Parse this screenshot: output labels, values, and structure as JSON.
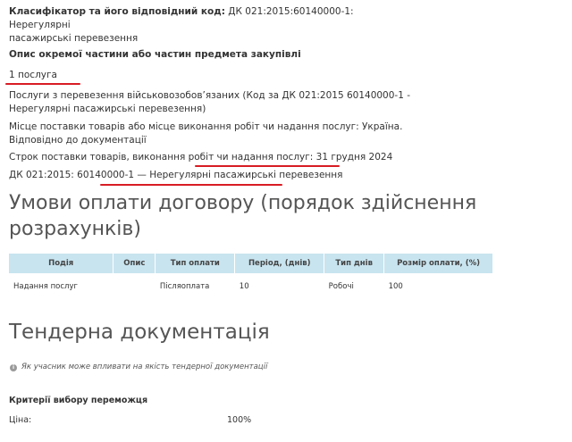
{
  "classifier": {
    "label": "Класифікатор та його відповідний код:",
    "value_line1": "ДК 021:2015:60140000-1: Нерегулярні",
    "value_line2": "пасажирські перевезення"
  },
  "lot_description": {
    "heading": "Опис окремої частини або частин предмета закупівлі",
    "quantity": "1 послуга",
    "service_line1": "Послуги з перевезення військовозобов’язаних (Код за ДК 021:2015 60140000-1 -",
    "service_line2": "Нерегулярні пасажирські перевезення)",
    "place_line1": "Місце поставки товарів або місце виконання робіт чи надання послуг: Україна.",
    "place_line2": "Відповідно до документації",
    "term": "Строк поставки товарів, виконання робіт чи надання послуг: 31 грудня 2024",
    "classifier_code": "ДК 021:2015: 60140000-1 — Нерегулярні пасажирські перевезення"
  },
  "payment_terms": {
    "heading_line1": "Умови оплати договору (порядок здійснення",
    "heading_line2": "розрахунків)",
    "columns": [
      "Подія",
      "Опис",
      "Тип оплати",
      "Період, (днів)",
      "Тип днів",
      "Розмір оплати, (%)"
    ],
    "rows": [
      [
        "Надання послуг",
        "",
        "Післяоплата",
        "10",
        "Робочі",
        "100"
      ]
    ]
  },
  "tender_docs": {
    "heading": "Тендерна документація",
    "info_link": "Як учасник може впливати на якість тендерної документації",
    "info_icon": "info-icon"
  },
  "criteria": {
    "heading": "Критерії вибору переможця",
    "label": "Ціна:",
    "value": "100%"
  },
  "colors": {
    "annotation_red": "#d81c24",
    "table_header_bg": "#c8e4ef"
  }
}
